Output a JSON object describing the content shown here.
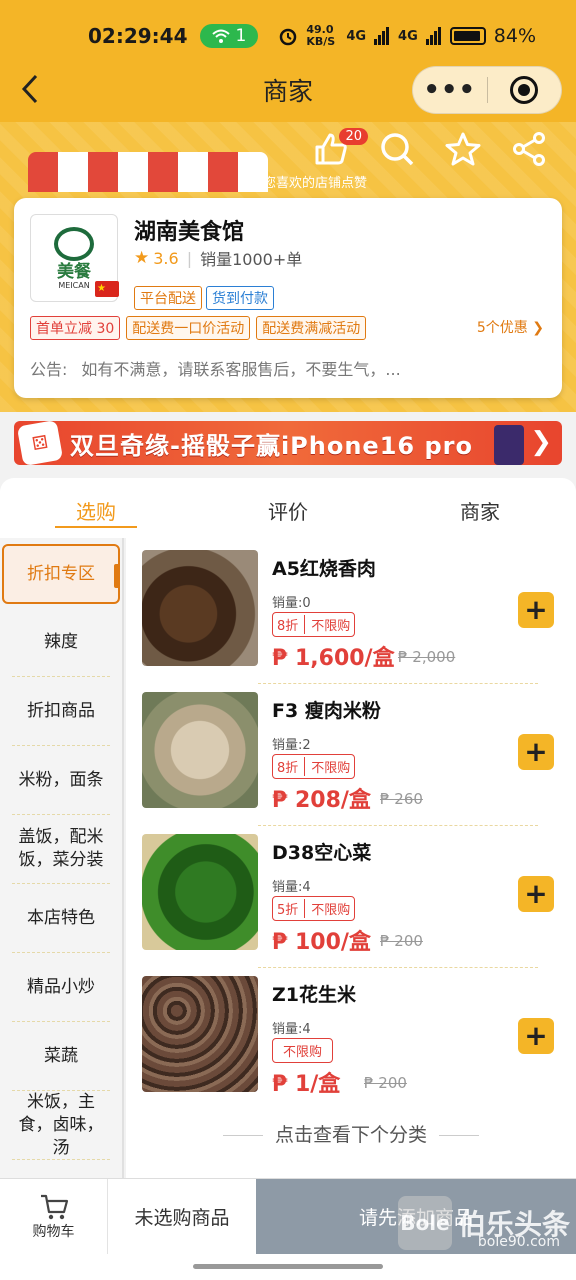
{
  "status_bar": {
    "time": "02:29:44",
    "wifi_count": "1",
    "net_speed": "49.0 KB/S",
    "signal1": "4G",
    "signal2": "4G",
    "battery": "84%"
  },
  "titlebar": {
    "title": "商家",
    "back_icon": "chevron-left-icon",
    "more_label": "•••"
  },
  "hero": {
    "like_count": "20",
    "hint": "为您喜欢的店铺点赞"
  },
  "shop": {
    "name": "湖南美食馆",
    "logo_text": "美餐",
    "logo_sub": "MEICAN",
    "rating": "3.6",
    "sales": "销量1000+单",
    "service_tags": [
      "平台配送",
      "货到付款"
    ],
    "promo_tags": [
      "首单立减 30",
      "配送费一口价活动",
      "配送费满减活动"
    ],
    "promo_more": "5个优惠",
    "notice_label": "公告:",
    "notice_text": "如有不满意，请联系客服售后，不要生气，..."
  },
  "promo_banner": {
    "text": "双旦奇缘-摇骰子赢iPhone16 pro"
  },
  "tabs": [
    "选购",
    "评价",
    "商家"
  ],
  "categories": [
    "折扣专区",
    "辣度",
    "折扣商品",
    "米粉，面条",
    "盖饭，配米饭，菜分装",
    "本店特色",
    "精品小炒",
    "菜蔬",
    "米饭，主食，卤味，汤"
  ],
  "items": [
    {
      "name": "A5红烧香肉",
      "sales": "销量:0",
      "discount": "8折",
      "limit": "不限购",
      "price": "₱ 1,600/盒",
      "original": "₱ 2,000"
    },
    {
      "name": "F3 瘦肉米粉",
      "sales": "销量:2",
      "discount": "8折",
      "limit": "不限购",
      "price": "₱ 208/盒",
      "original": "₱ 260"
    },
    {
      "name": "D38空心菜",
      "sales": "销量:4",
      "discount": "5折",
      "limit": "不限购",
      "price": "₱ 100/盒",
      "original": "₱ 200"
    },
    {
      "name": "Z1花生米",
      "sales": "销量:4",
      "discount": "",
      "limit": "不限购",
      "price": "₱ 1/盒",
      "original": "₱ 200"
    }
  ],
  "next_category": "点击查看下个分类",
  "bottom_bar": {
    "cart_label": "购物车",
    "not_selected": "未选购商品",
    "add_first": "请先添加商品"
  },
  "watermark": {
    "badge": "Bole",
    "title": "伯乐头条",
    "url": "bole90.com"
  },
  "colors": {
    "brand_yellow": "#f4b527",
    "accent_orange": "#e07a12",
    "price_red": "#e1403a",
    "disabled_gray": "#8e9aa6"
  }
}
